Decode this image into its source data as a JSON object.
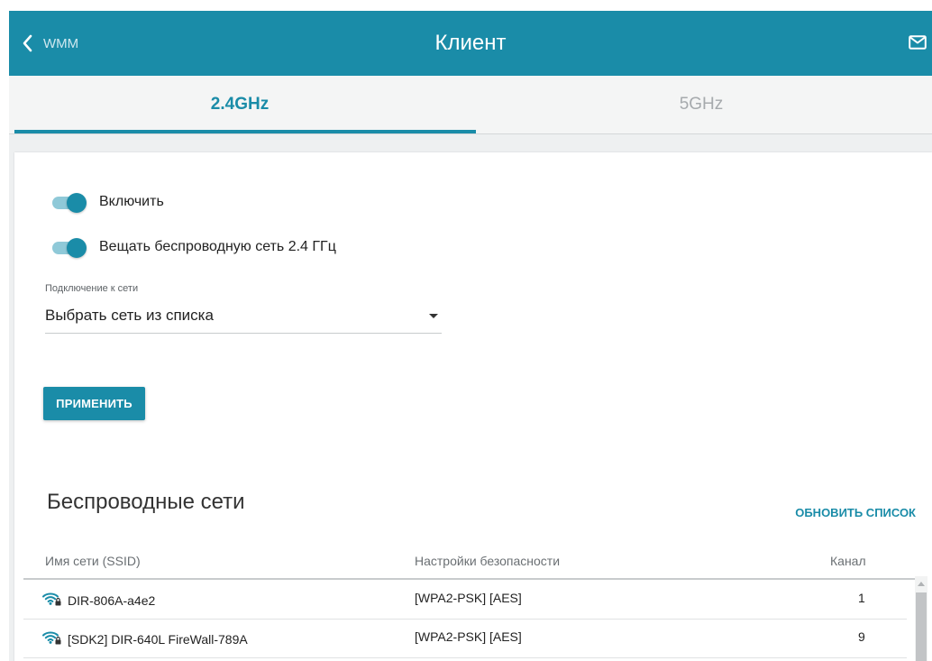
{
  "header": {
    "back_label": "WMM",
    "title": "Клиент",
    "back_icon": "chevron-left-icon",
    "mail_icon": "mail-icon"
  },
  "tabs": [
    {
      "label": "2.4GHz",
      "active": true
    },
    {
      "label": "5GHz",
      "active": false
    }
  ],
  "form": {
    "enable_label": "Включить",
    "enable_on": true,
    "broadcast_label": "Вещать беспроводную сеть 2.4 ГГц",
    "broadcast_on": true,
    "connection_label": "Подключение к сети",
    "connection_value": "Выбрать сеть из списка",
    "apply_label": "ПРИМЕНИТЬ"
  },
  "networks": {
    "title": "Беспроводные сети",
    "refresh_label": "ОБНОВИТЬ СПИСОК",
    "columns": [
      "Имя сети (SSID)",
      "Настройки безопасности",
      "Канал"
    ],
    "rows": [
      {
        "ssid": "DIR-806A-a4e2",
        "security": "[WPA2-PSK] [AES]",
        "channel": "1",
        "icon": "wifi-locked-icon"
      },
      {
        "ssid": "[SDK2] DIR-640L FireWall-789A",
        "security": "[WPA2-PSK] [AES]",
        "channel": "9",
        "icon": "wifi-locked-icon"
      }
    ]
  },
  "colors": {
    "accent": "#1a8ca8",
    "tab_inactive": "#a6aaad",
    "background": "#eef0f1"
  }
}
